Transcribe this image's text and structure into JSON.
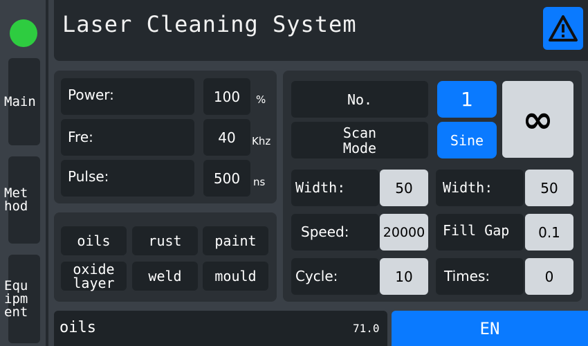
{
  "header": {
    "title": "Laser Cleaning System",
    "warning_icon": "warning-icon"
  },
  "status": {
    "color": "#2ecc40"
  },
  "nav": {
    "main": "Main",
    "method": "Method",
    "equipment": "Equipment"
  },
  "params": {
    "power": {
      "label": "Power:",
      "value": "100",
      "unit": "%"
    },
    "fre": {
      "label": "Fre:",
      "value": "40",
      "unit": "Khz"
    },
    "pulse": {
      "label": "Pulse:",
      "value": "500",
      "unit": "ns"
    }
  },
  "materials": [
    "oils",
    "rust",
    "paint",
    "oxide layer",
    "weld",
    "mould"
  ],
  "scan": {
    "no_label": "No.",
    "no_value": "1",
    "mode_label": "Scan Mode",
    "mode_value": "Sine",
    "shape_symbol": "∞"
  },
  "settings": {
    "width_left": {
      "label": "Width:",
      "value": "50"
    },
    "speed": {
      "label": "Speed:",
      "value": "20000"
    },
    "cycle": {
      "label": "Cycle:",
      "value": "10"
    },
    "width_right": {
      "label": "Width:",
      "value": "50"
    },
    "fill_gap": {
      "label": "Fill Gap",
      "value": "0.1"
    },
    "times": {
      "label": "Times:",
      "value": "0"
    }
  },
  "footer": {
    "selected": "oils",
    "reading": "71.0",
    "enable_label": "EN"
  },
  "colors": {
    "accent": "#0a7aff",
    "background": "#3a4047",
    "cell": "#1e2327",
    "light": "#d3d8dd"
  }
}
